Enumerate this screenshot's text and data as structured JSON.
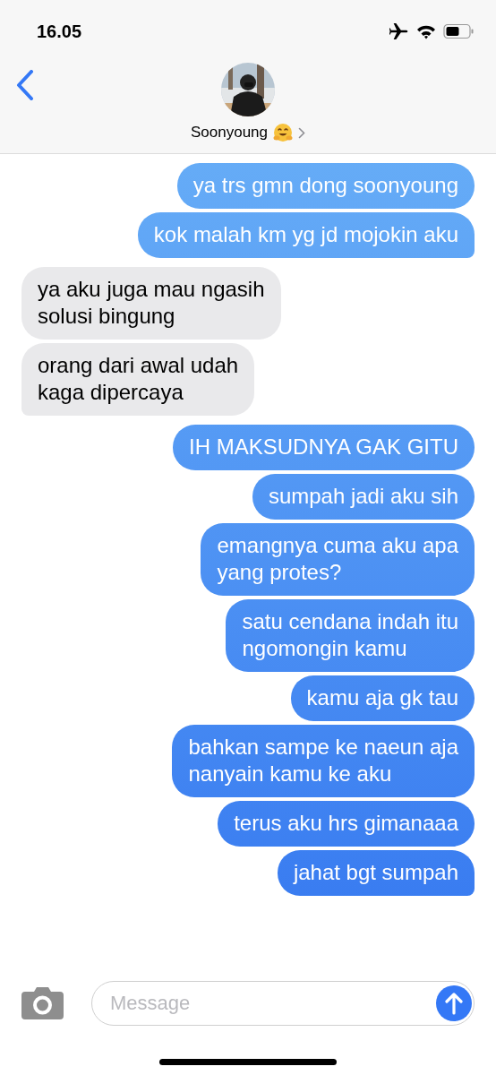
{
  "status_bar": {
    "time": "16.05"
  },
  "header": {
    "contact_name": "Soonyoung"
  },
  "messages": [
    {
      "kind": "sent",
      "text": "ya trs gmn dong soonyoung"
    },
    {
      "kind": "sent",
      "text": "kok malah km yg jd mojokin aku"
    },
    {
      "kind": "received",
      "text": "ya aku juga mau ngasih\nsolusi bingung"
    },
    {
      "kind": "received",
      "text": "orang dari awal udah\nkaga dipercaya"
    },
    {
      "kind": "sent",
      "text": "IH MAKSUDNYA GAK GITU"
    },
    {
      "kind": "sent",
      "text": "sumpah jadi aku sih"
    },
    {
      "kind": "sent",
      "text": "emangnya cuma aku apa\nyang protes?"
    },
    {
      "kind": "sent",
      "text": "satu cendana indah itu\nngomongin kamu"
    },
    {
      "kind": "sent",
      "text": "kamu aja gk tau"
    },
    {
      "kind": "sent",
      "text": "bahkan sampe ke naeun aja\nnanyain kamu ke aku"
    },
    {
      "kind": "sent",
      "text": "terus aku hrs gimanaaa"
    },
    {
      "kind": "sent",
      "text": "jahat bgt sumpah"
    }
  ],
  "composer": {
    "placeholder": "Message"
  }
}
